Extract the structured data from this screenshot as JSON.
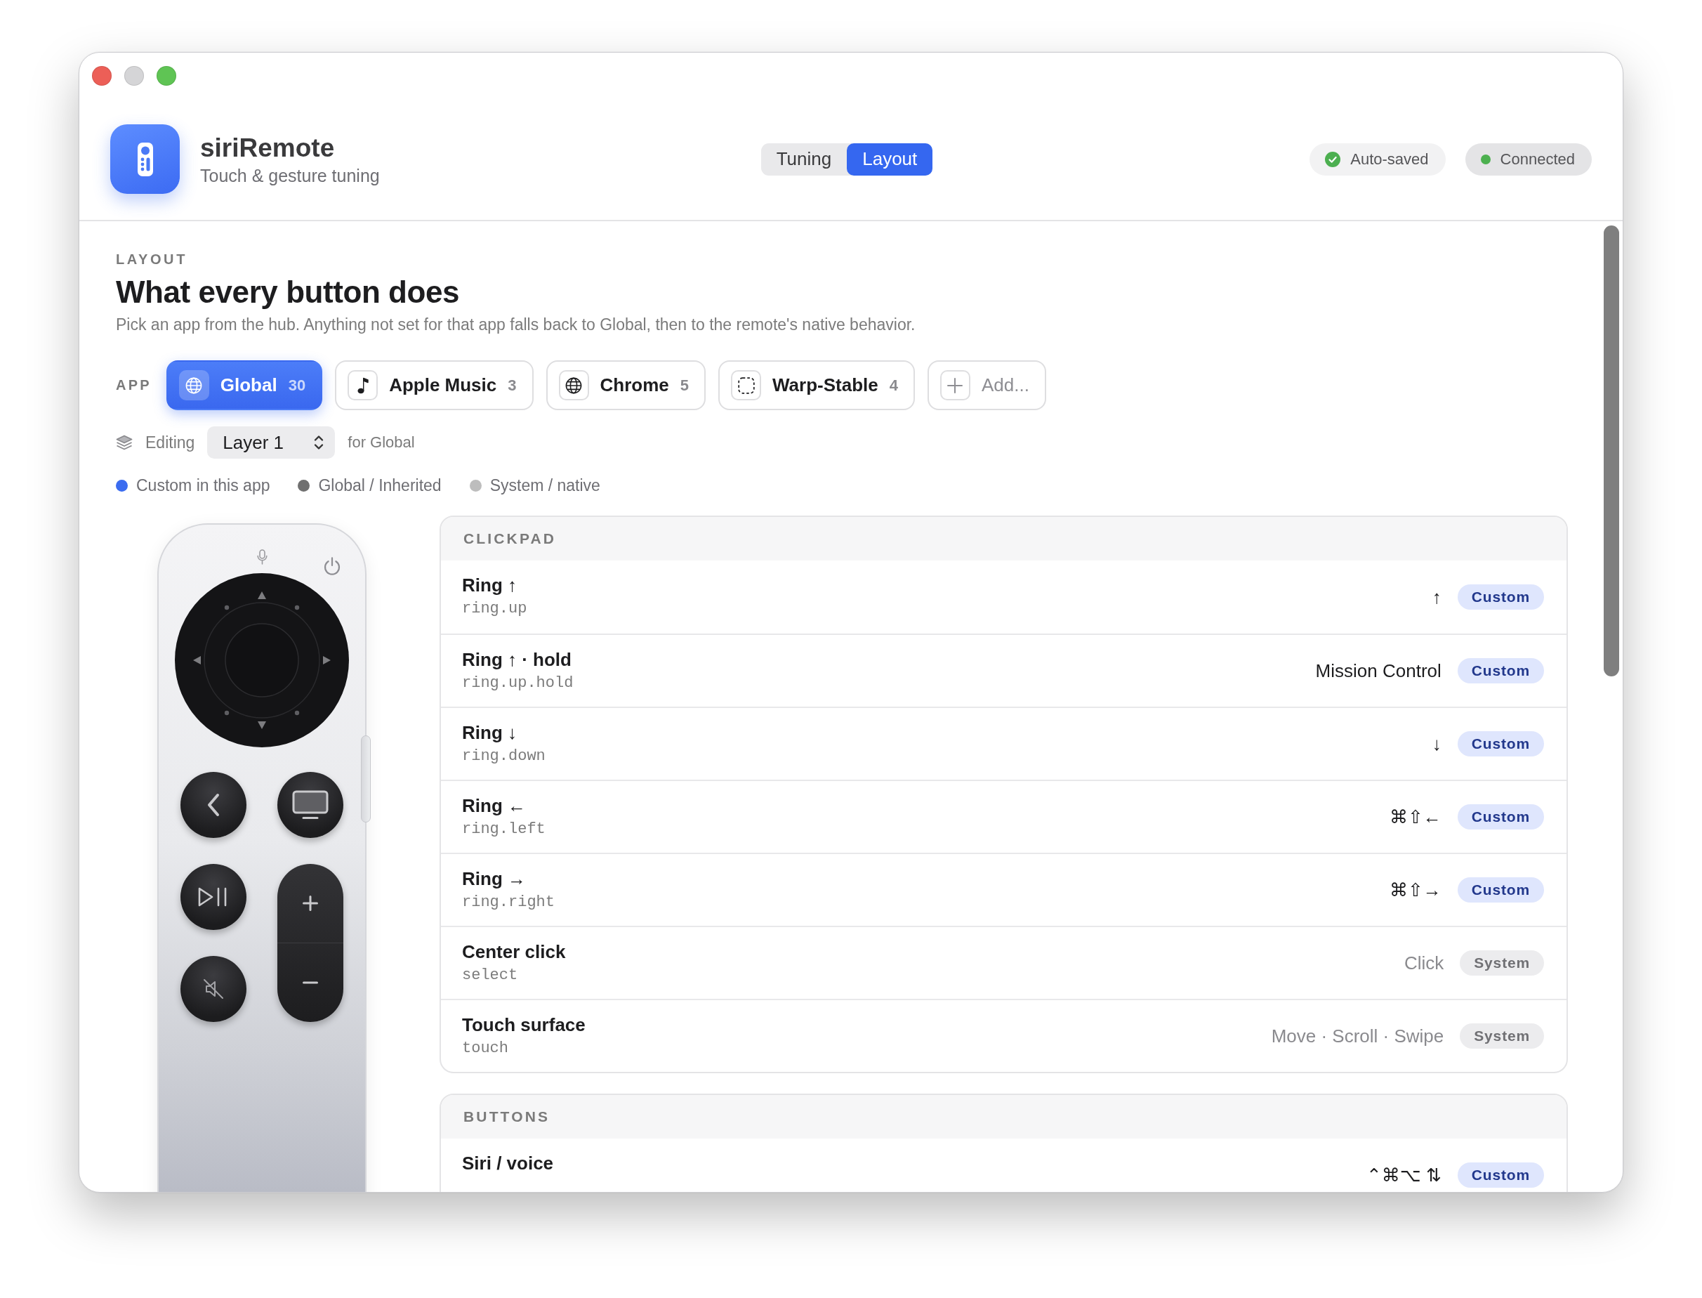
{
  "app": {
    "title": "siriRemote",
    "subtitle": "Touch & gesture tuning"
  },
  "mode_tabs": [
    {
      "label": "Tuning",
      "selected": false
    },
    {
      "label": "Layout",
      "selected": true
    }
  ],
  "status": [
    {
      "label": "Auto-saved",
      "kind": "saved"
    },
    {
      "label": "Connected",
      "kind": "connected"
    }
  ],
  "section": {
    "eyebrow": "LAYOUT",
    "title": "What every button does",
    "description": "Pick an app from the hub. Anything not set for that app falls back to Global, then to the remote's native behavior."
  },
  "app_picker": {
    "label": "APP",
    "apps": [
      {
        "name": "Global",
        "count": "30",
        "selected": true,
        "kind": "app"
      },
      {
        "name": "Apple Music",
        "count": "3",
        "selected": false,
        "kind": "app"
      },
      {
        "name": "Chrome",
        "count": "5",
        "selected": false,
        "kind": "app"
      },
      {
        "name": "Warp-Stable",
        "count": "4",
        "selected": false,
        "kind": "app"
      },
      {
        "name": "Add...",
        "selected": false,
        "kind": "add"
      }
    ]
  },
  "editing": {
    "label": "Editing",
    "layer": "Layer 1",
    "scope": "for Global"
  },
  "legend": [
    {
      "label": "Custom in this app",
      "color": "#3b6cf0"
    },
    {
      "label": "Global / Inherited",
      "color": "#707070"
    },
    {
      "label": "System / native",
      "color": "#bdbdbd"
    }
  ],
  "groups": [
    {
      "title": "CLICKPAD",
      "rows": [
        {
          "name": "Ring ↑",
          "key": "ring.up",
          "value": "↑",
          "badge": "Custom",
          "kind": "custom"
        },
        {
          "name": "Ring ↑ · hold",
          "key": "ring.up.hold",
          "value": "Mission Control",
          "badge": "Custom",
          "kind": "custom"
        },
        {
          "name": "Ring ↓",
          "key": "ring.down",
          "value": "↓",
          "badge": "Custom",
          "kind": "custom"
        },
        {
          "name": "Ring ←",
          "key": "ring.left",
          "value": "⌘⇧←",
          "badge": "Custom",
          "kind": "custom"
        },
        {
          "name": "Ring →",
          "key": "ring.right",
          "value": "⌘⇧→",
          "badge": "Custom",
          "kind": "custom"
        },
        {
          "name": "Center click",
          "key": "select",
          "value": "Click",
          "badge": "System",
          "kind": "system"
        },
        {
          "name": "Touch surface",
          "key": "touch",
          "value": "Move · Scroll · Swipe",
          "badge": "System",
          "kind": "system"
        }
      ]
    },
    {
      "title": "BUTTONS",
      "rows": [
        {
          "name": "Siri / voice",
          "value": "⌃⌘⌥ ⇅",
          "badge": "Custom",
          "kind": "custom"
        }
      ]
    }
  ]
}
